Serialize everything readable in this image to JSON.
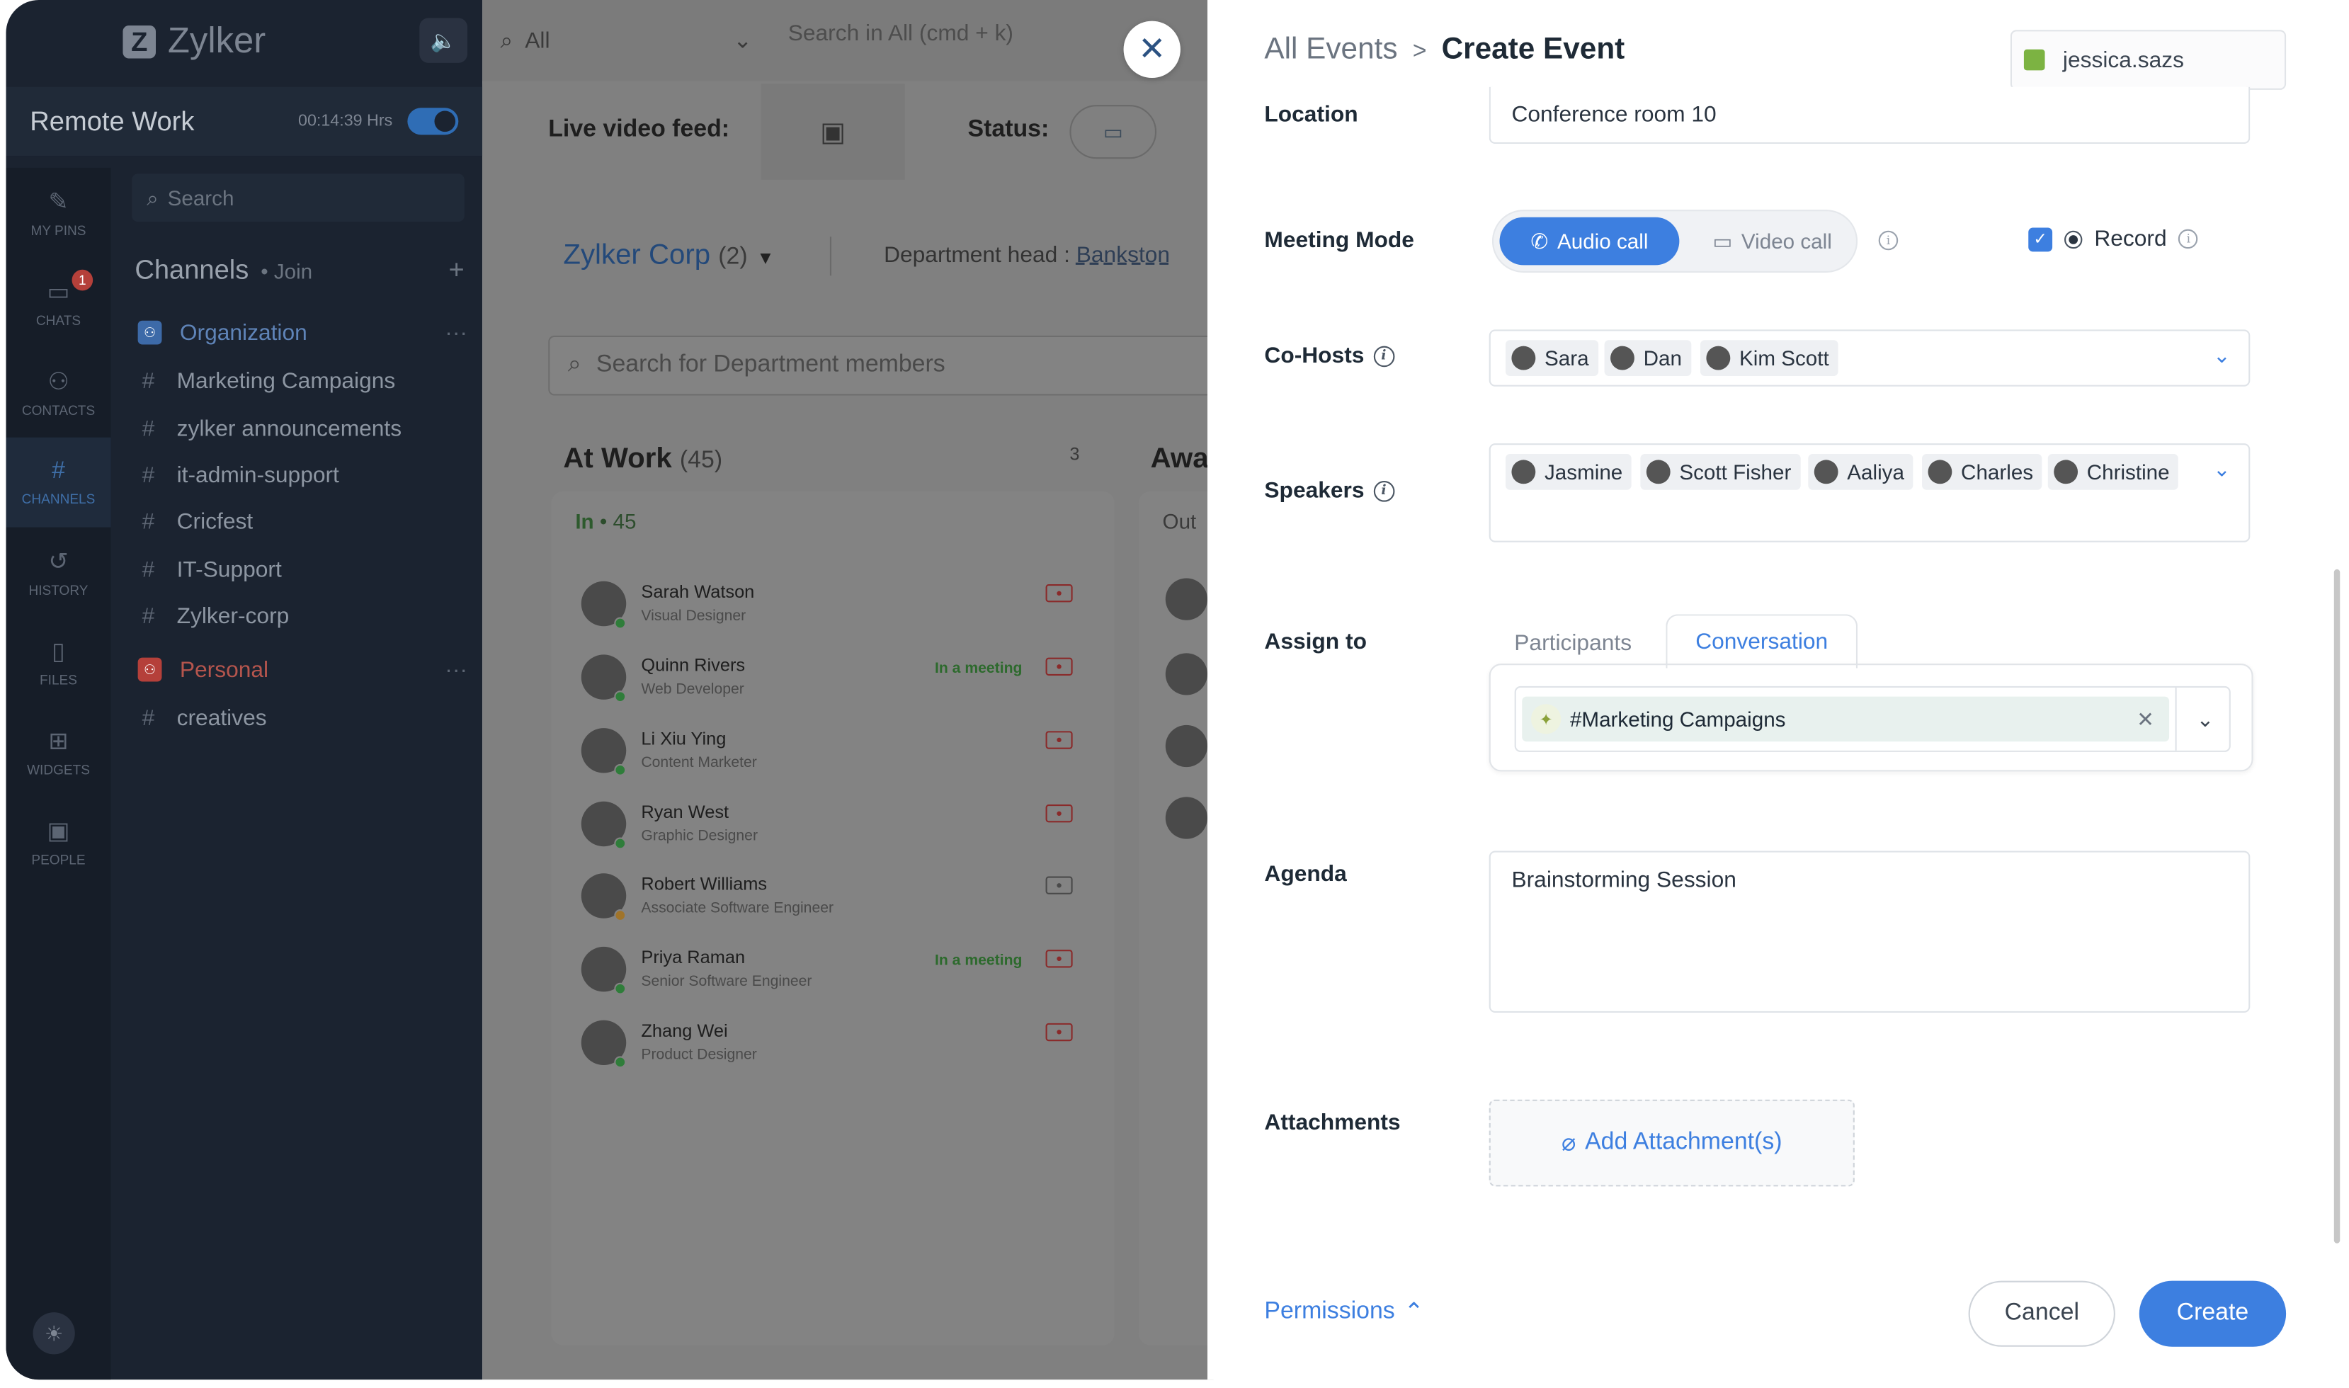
{
  "app": {
    "brand": "Zylker",
    "workspace": "Remote Work",
    "timer": "00:14:39 Hrs",
    "search_placeholder": "Search"
  },
  "rail": [
    {
      "label": "MY PINS",
      "icon": "pin-icon"
    },
    {
      "label": "CHATS",
      "icon": "chat-icon",
      "badge": "1"
    },
    {
      "label": "CONTACTS",
      "icon": "contacts-icon"
    },
    {
      "label": "CHANNELS",
      "icon": "hash-icon"
    },
    {
      "label": "HISTORY",
      "icon": "history-icon"
    },
    {
      "label": "FILES",
      "icon": "file-icon"
    },
    {
      "label": "WIDGETS",
      "icon": "widgets-icon"
    },
    {
      "label": "PEOPLE",
      "icon": "people-icon"
    }
  ],
  "channels": {
    "title": "Channels",
    "join": "• Join",
    "items": [
      "Organization",
      "Marketing Campaigns",
      "zylker announcements",
      "it-admin-support",
      "Cricfest",
      "IT-Support",
      "Zylker-corp",
      "Personal",
      "creatives"
    ]
  },
  "main": {
    "scope": "All",
    "search_placeholder": "Search in All (cmd + k)",
    "live_video_label": "Live video feed:",
    "status_label": "Status:",
    "org": "Zylker Corp",
    "org_count": "(2)",
    "dept_head_label": "Department head :",
    "dept_head": "Bankston",
    "member_search": "Search for Department members",
    "at_work": "At Work",
    "at_work_count": "(45)",
    "three": "3",
    "away": "Away",
    "in_label": "In",
    "in_count": "45",
    "out_label": "Out",
    "members": [
      {
        "name": "Sarah Watson",
        "role": "Visual Designer",
        "meeting": ""
      },
      {
        "name": "Quinn Rivers",
        "role": "Web Developer",
        "meeting": "In a meeting"
      },
      {
        "name": "Li Xiu Ying",
        "role": "Content Marketer",
        "meeting": ""
      },
      {
        "name": "Ryan West",
        "role": "Graphic Designer",
        "meeting": ""
      },
      {
        "name": "Robert Williams",
        "role": "Associate Software Engineer",
        "meeting": ""
      },
      {
        "name": "Priya Raman",
        "role": "Senior Software Engineer",
        "meeting": "In a meeting"
      },
      {
        "name": "Zhang Wei",
        "role": "Product Designer",
        "meeting": ""
      }
    ]
  },
  "panel": {
    "crumb_parent": "All Events",
    "crumb_sep": ">",
    "crumb_current": "Create Event",
    "user": "jessica.sazs",
    "location_label": "Location",
    "location_value": "Conference room 10",
    "mode_label": "Meeting Mode",
    "mode_audio": "Audio call",
    "mode_video": "Video call",
    "record_label": "Record",
    "cohosts_label": "Co-Hosts",
    "cohosts": [
      "Sara",
      "Dan",
      "Kim Scott"
    ],
    "speakers_label": "Speakers",
    "speakers": [
      "Jasmine",
      "Scott Fisher",
      "Aaliya",
      "Charles",
      "Christine"
    ],
    "assign_label": "Assign to",
    "tab_participants": "Participants",
    "tab_conversation": "Conversation",
    "assigned": "#Marketing Campaigns",
    "agenda_label": "Agenda",
    "agenda_value": "Brainstorming Session",
    "attachments_label": "Attachments",
    "add_attachment": "Add Attachment(s)",
    "permissions": "Permissions",
    "cancel": "Cancel",
    "create": "Create"
  },
  "colors": {
    "accent": "#3d7fe0",
    "sidebar": "#1b2330",
    "overlay": "#808080"
  }
}
